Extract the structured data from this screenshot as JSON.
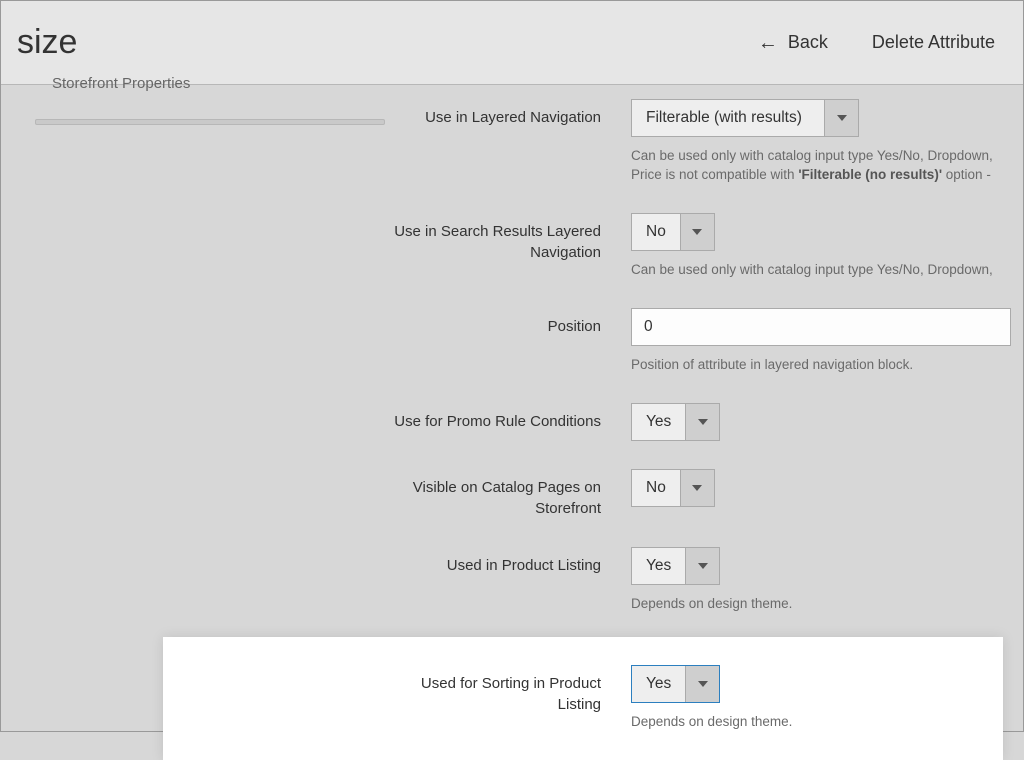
{
  "header": {
    "title": "size",
    "back_label": "Back",
    "delete_label": "Delete Attribute"
  },
  "sidebar": {
    "active_tab": "Storefront Properties"
  },
  "form": {
    "layered_nav": {
      "label": "Use in Layered Navigation",
      "value": "Filterable (with results)",
      "hint_prefix": "Can be used only with catalog input type Yes/No, Dropdown, ",
      "hint_mid": "Price is not compatible with ",
      "hint_bold": "'Filterable (no results)'",
      "hint_suffix": " option - "
    },
    "search_layered_nav": {
      "label": "Use in Search Results Layered Navigation",
      "value": "No",
      "hint": "Can be used only with catalog input type Yes/No, Dropdown, "
    },
    "position": {
      "label": "Position",
      "value": "0",
      "hint": "Position of attribute in layered navigation block."
    },
    "promo": {
      "label": "Use for Promo Rule Conditions",
      "value": "Yes"
    },
    "visible_catalog": {
      "label": "Visible on Catalog Pages on Storefront",
      "value": "No"
    },
    "product_listing": {
      "label": "Used in Product Listing",
      "value": "Yes",
      "hint": "Depends on design theme."
    },
    "sorting": {
      "label": "Used for Sorting in Product Listing",
      "value": "Yes",
      "hint": "Depends on design theme."
    }
  }
}
